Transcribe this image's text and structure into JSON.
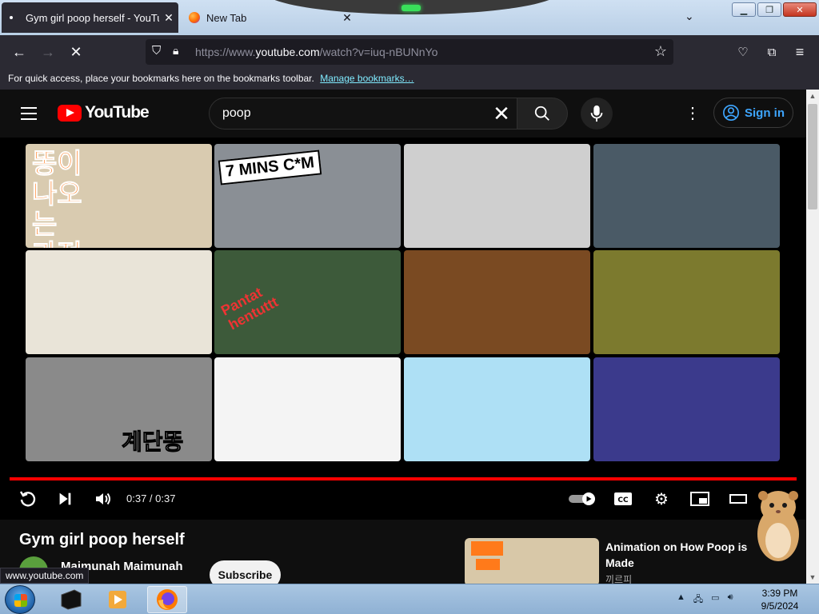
{
  "browser": {
    "tabs": [
      {
        "title": "Gym girl poop herself - YouTube",
        "active": true
      },
      {
        "title": "New Tab",
        "active": false
      }
    ],
    "url_prefix": "https://www.",
    "url_host": "youtube.com",
    "url_path": "/watch?v=iuq-nBUNnYo",
    "bookmarks_text": "For quick access, place your bookmarks here on the bookmarks toolbar.",
    "bookmarks_link": "Manage bookmarks…",
    "status_url": "www.youtube.com"
  },
  "youtube": {
    "logo_word": "YouTube",
    "search_value": "poop",
    "sign_in_label": "Sign in"
  },
  "thumbnails": [
    {
      "text": "똥이 나오는 과정",
      "bg": "#d9cbb0"
    },
    {
      "text": "7 MINS C*M",
      "bg": "#8a8f95"
    },
    {
      "text": "",
      "bg": "#cfcfcf"
    },
    {
      "text": "",
      "bg": "#4a5a66"
    },
    {
      "text": "",
      "bg": "#e9e4d8"
    },
    {
      "text": "Pantat hentuttt",
      "bg": "#3d5a3a"
    },
    {
      "text": "",
      "bg": "#7a4a22"
    },
    {
      "text": "",
      "bg": "#7c7a2e"
    },
    {
      "text": "계단똥",
      "bg": "#8a8a8a"
    },
    {
      "text": "",
      "bg": "#f4f4f4"
    },
    {
      "text": "",
      "bg": "#aee0f5"
    },
    {
      "text": "",
      "bg": "#3b3a8c"
    }
  ],
  "player": {
    "time_display": "0:37 / 0:37",
    "progress": 1.0
  },
  "video": {
    "title": "Gym girl poop herself",
    "channel": "Maimunah Maimunah",
    "subscribe_label": "Subscribe"
  },
  "recommendation": {
    "title": "Animation on How Poop is Made",
    "channel": "끼르피"
  },
  "taskbar": {
    "time": "3:39 PM",
    "date": "9/5/2024"
  },
  "colors": {
    "yt_red": "#ff0000",
    "link_blue": "#3ea6ff",
    "browser_dark": "#2b2a33"
  }
}
